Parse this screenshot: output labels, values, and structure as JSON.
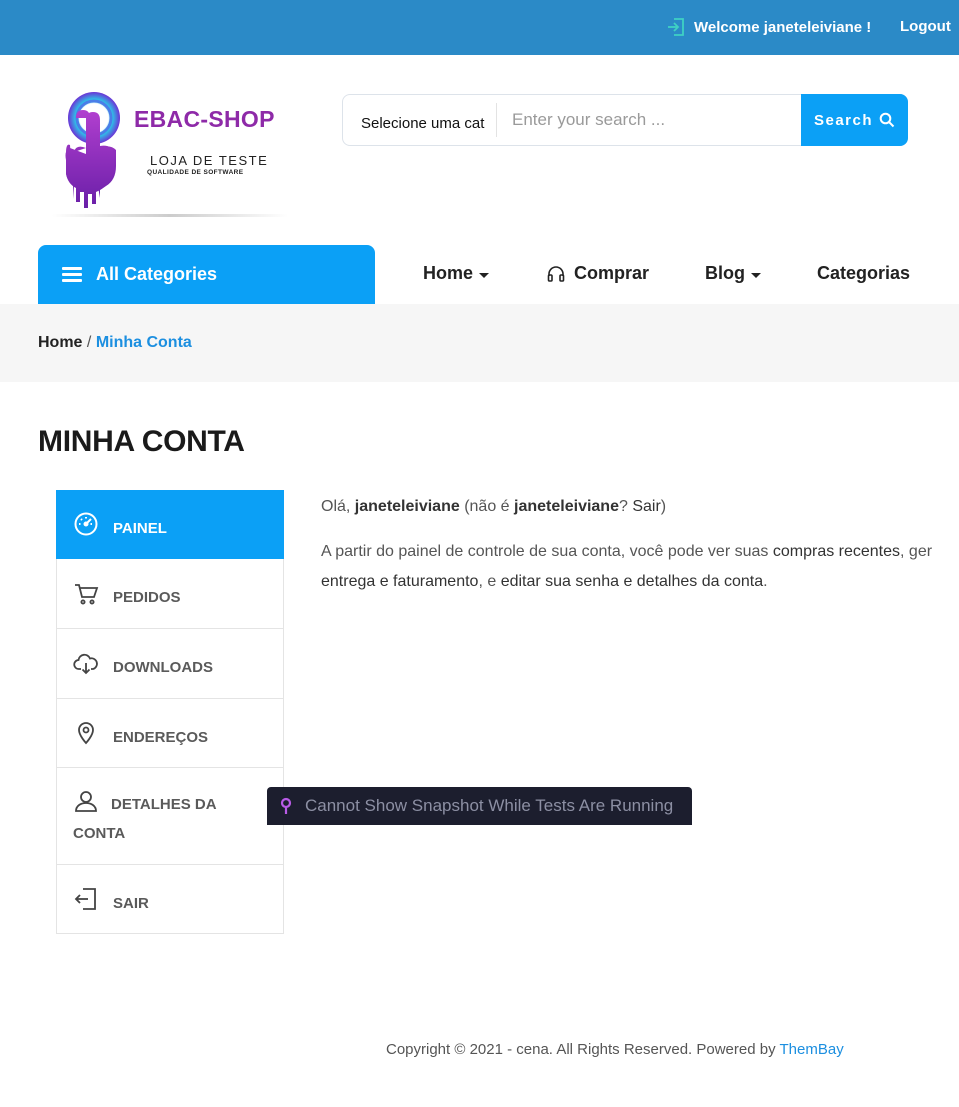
{
  "topbar": {
    "welcome": "Welcome janeteleiviane !",
    "logout": "Logout"
  },
  "logo": {
    "title": "EBAC-SHOP",
    "subtitle": "LOJA DE TESTE",
    "tagline": "QUALIDADE DE SOFTWARE"
  },
  "search": {
    "category": "Selecione uma cat",
    "placeholder": "Enter your search ...",
    "button": "Search"
  },
  "nav": {
    "all_categories": "All Categories",
    "items": [
      {
        "label": "Home",
        "has_dropdown": true
      },
      {
        "label": "Comprar",
        "icon": "headphones-icon"
      },
      {
        "label": "Blog",
        "has_dropdown": true
      },
      {
        "label": "Categorias"
      }
    ]
  },
  "breadcrumb": {
    "home": "Home",
    "separator": "/",
    "current": "Minha Conta"
  },
  "page_title": "MINHA CONTA",
  "account_menu": [
    {
      "label": "PAINEL",
      "icon": "dashboard-gauge-icon",
      "active": true
    },
    {
      "label": "PEDIDOS",
      "icon": "cart-icon"
    },
    {
      "label": "DOWNLOADS",
      "icon": "cloud-download-icon"
    },
    {
      "label": "ENDEREÇOS",
      "icon": "map-pin-icon"
    },
    {
      "label": "DETALHES DA CONTA",
      "icon": "user-icon"
    },
    {
      "label": "SAIR",
      "icon": "sign-out-icon"
    }
  ],
  "content": {
    "greeting_prefix": "Olá,",
    "username": "janeteleiviane",
    "not_prefix": "(não é",
    "not_user": "janeteleiviane",
    "q": "?",
    "logout_link": "Sair",
    "close_paren": ")",
    "line2_prefix": "A partir do painel de controle de sua conta, você pode ver suas",
    "recent_orders": "compras recentes",
    "line2_suffix": ", ger",
    "addresses": "entrega e faturamento",
    "mid": ", e",
    "edit": "editar sua senha e detalhes da conta",
    "end": "."
  },
  "overlay": {
    "message": "Cannot Show Snapshot While Tests Are Running"
  },
  "footer": {
    "text": "Copyright © 2021 - cena. All Rights Reserved. Powered by",
    "link": "ThemBay"
  },
  "colors": {
    "topbar": "#2b8ac7",
    "accent": "#0ba0f6",
    "link": "#1c8fe0",
    "logo": "#8e2aa8",
    "overlay": "#1c1e2e"
  }
}
